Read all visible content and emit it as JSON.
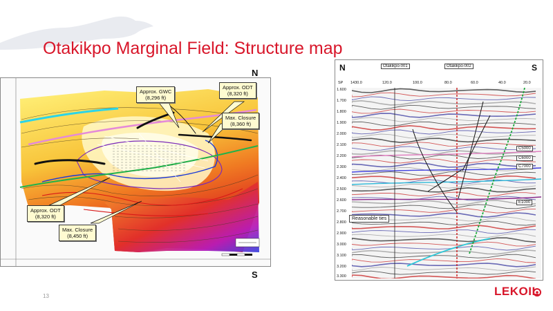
{
  "slide": {
    "title": "Otakikpo Marginal Field:  Structure map",
    "page_number": "13",
    "logo_text": "LEKOIL",
    "accent_color": "#d8162a"
  },
  "map": {
    "north_label": "N",
    "south_label": "S",
    "callouts": {
      "gwc": {
        "line1": "Approx. GWC",
        "line2": "(8,296 ft)"
      },
      "odt_top": {
        "line1": "Approx. ODT",
        "line2": "(8,320 ft)"
      },
      "closure_top": {
        "line1": "Max. Closure",
        "line2": "(8,360 ft)"
      },
      "odt_bottom": {
        "line1": "Approx. ODT",
        "line2": "(8,320 ft)"
      },
      "closure_bottom": {
        "line1": "Max. Closure",
        "line2": "(8,450 ft)"
      }
    }
  },
  "seismic": {
    "compass_left": "N",
    "compass_right": "S",
    "wells": [
      "Otakikpo-001",
      "Otakikpo-002"
    ],
    "sp_label": "SP",
    "sp_values": [
      "1430.0",
      "120.0",
      "100.0",
      "80.0",
      "60.0",
      "40.0",
      "20.0"
    ],
    "time_ticks": [
      "1.600",
      "1.700",
      "1.800",
      "1.900",
      "2.000",
      "2.100",
      "2.200",
      "2.300",
      "2.400",
      "2.500",
      "2.600",
      "2.700",
      "2.800",
      "2.900",
      "3.000",
      "3.100",
      "3.200",
      "3.300"
    ],
    "horizons": [
      "C5000",
      "C6000",
      "C7000",
      "E1000"
    ],
    "tie_label": "Reasonable ties"
  }
}
